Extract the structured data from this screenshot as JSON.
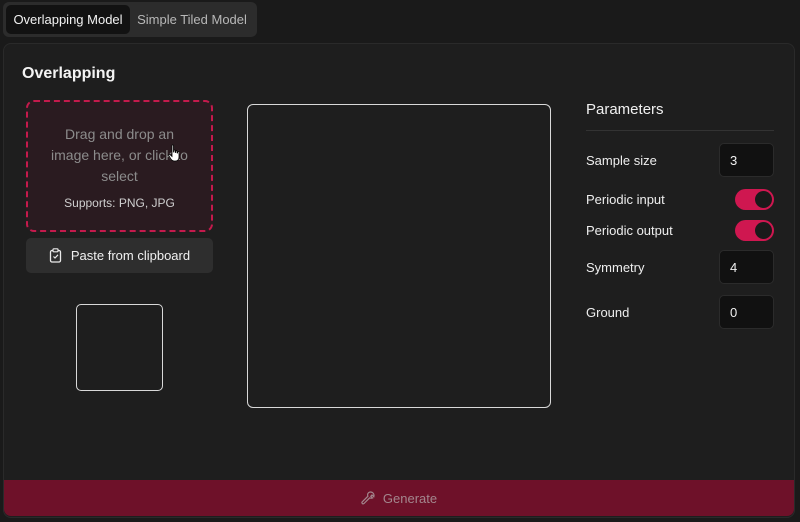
{
  "tabs": [
    {
      "label": "Overlapping Model",
      "active": true
    },
    {
      "label": "Simple Tiled Model",
      "active": false
    }
  ],
  "panel": {
    "title": "Overlapping",
    "dropzone": {
      "main_text": "Drag and drop an image here, or click to select",
      "supports_text": "Supports: PNG, JPG"
    },
    "paste_button_label": "Paste from clipboard",
    "parameters": {
      "title": "Parameters",
      "sample_size": {
        "label": "Sample size",
        "value": "3"
      },
      "periodic_input": {
        "label": "Periodic input",
        "checked": true
      },
      "periodic_output": {
        "label": "Periodic output",
        "checked": true
      },
      "symmetry": {
        "label": "Symmetry",
        "value": "4"
      },
      "ground": {
        "label": "Ground",
        "value": "0"
      }
    },
    "generate_label": "Generate"
  },
  "colors": {
    "accent": "#cf1750",
    "generate_bg": "#6e1129",
    "dropzone_border": "#c41a4c"
  },
  "icons": {
    "paste": "clipboard-icon",
    "generate": "wrench-icon",
    "cursor": "hand-pointer-icon"
  }
}
